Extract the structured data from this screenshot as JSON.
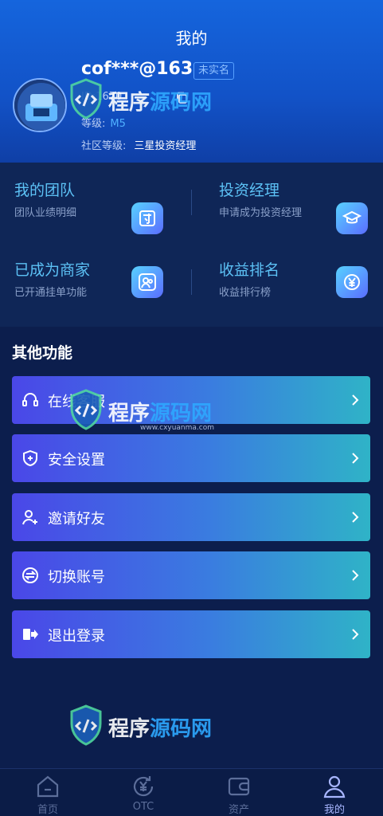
{
  "header": {
    "title": "我的",
    "username": "cof***@163",
    "verify_badge": "未实名",
    "uid": "ID:1670",
    "level_label": "等级:",
    "level_value": "M5",
    "community_label": "社区等级:",
    "community_value": "三星投资经理"
  },
  "features": [
    {
      "title": "我的团队",
      "subtitle": "团队业绩明细",
      "icon": "team-icon"
    },
    {
      "title": "投资经理",
      "subtitle": "申请成为投资经理",
      "icon": "graduation-cap-icon"
    },
    {
      "title": "已成为商家",
      "subtitle": "已开通挂单功能",
      "icon": "merchant-icon"
    },
    {
      "title": "收益排名",
      "subtitle": "收益排行榜",
      "icon": "yen-ranking-icon"
    }
  ],
  "other": {
    "title": "其他功能",
    "items": [
      {
        "label": "在线客服",
        "icon": "headset-icon"
      },
      {
        "label": "安全设置",
        "icon": "shield-icon"
      },
      {
        "label": "邀请好友",
        "icon": "add-user-icon"
      },
      {
        "label": "切换账号",
        "icon": "switch-icon"
      },
      {
        "label": "退出登录",
        "icon": "logout-icon"
      }
    ]
  },
  "tabbar": {
    "items": [
      {
        "label": "首页",
        "icon": "home-icon"
      },
      {
        "label": "OTC",
        "icon": "otc-icon"
      },
      {
        "label": "资产",
        "icon": "wallet-icon"
      },
      {
        "label": "我的",
        "icon": "user-icon"
      }
    ],
    "active_index": 3
  },
  "watermark": {
    "text_a": "程序",
    "text_b": "源码网",
    "url": "www.cxyuanma.com"
  },
  "colors": {
    "header_top": "#1565dd",
    "page_bg": "#0c1e4d",
    "feature_title": "#5cc1f5",
    "menu_gradient_start": "#4a47e8",
    "menu_gradient_end": "#2fb3c7",
    "tab_active": "#a8b6ff"
  }
}
